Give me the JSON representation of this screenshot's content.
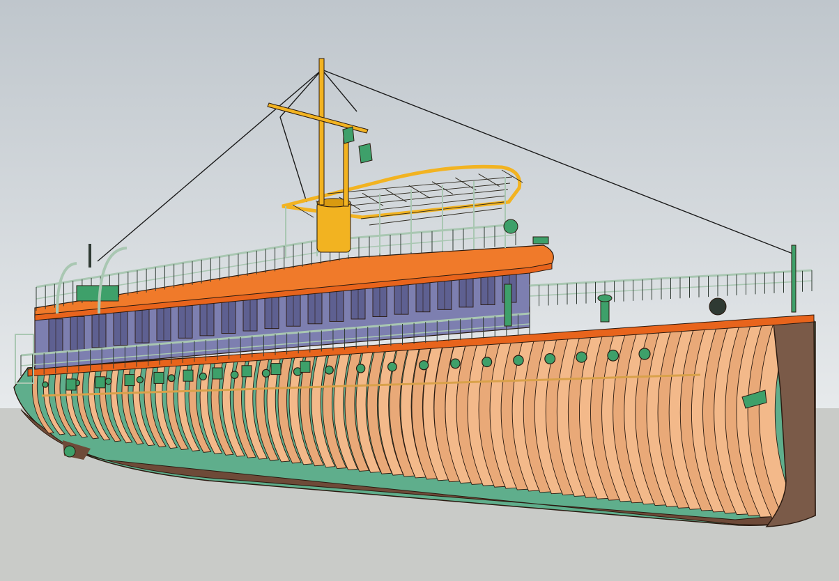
{
  "scene": {
    "subject": "steamship-hull-model",
    "colors": {
      "sky_top": "#bfc6cc",
      "sky_bottom": "#e7eaec",
      "ground": "#c9cbc8",
      "frames": "#f3b98a",
      "frames_dark": "#e9a978",
      "frame_stroke": "#2a1a10",
      "interior": "#5fae8c",
      "bow_plate": "#7a5a48",
      "keel": "#6e4a38",
      "deck_edge": "#e8641c",
      "rail": "#a9c7b2",
      "superstructure": "#7d7fb0",
      "superstructure_dark": "#5e6091",
      "funnel": "#f2b321",
      "mast": "#f2b321",
      "fitting": "#3ea06a",
      "rigging": "#1b1b1b"
    },
    "counts": {
      "hull_frames": 66,
      "portholes": 20,
      "windows": 22
    }
  }
}
